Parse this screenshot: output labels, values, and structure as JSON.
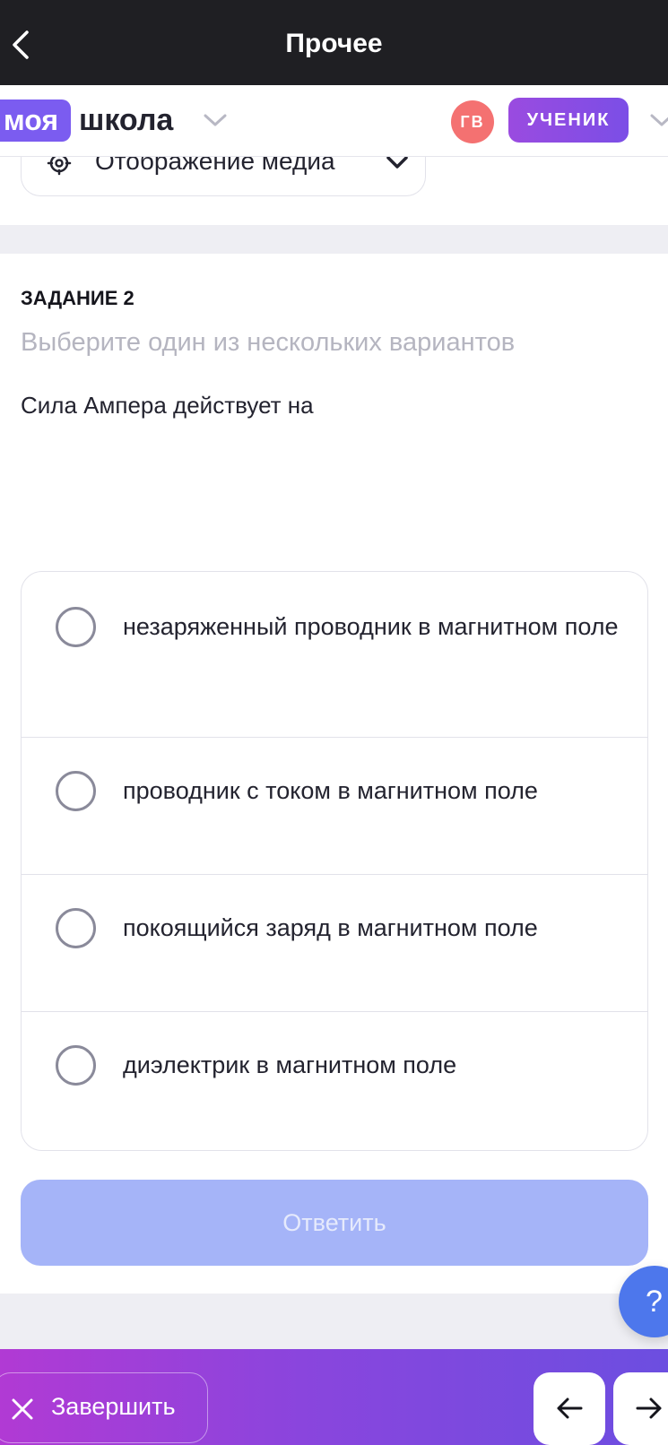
{
  "topbar": {
    "title": "Прочее"
  },
  "header": {
    "logo_badge": "моя",
    "logo_text": "школа",
    "avatar_initials": "ГВ",
    "role": "УЧЕНИК"
  },
  "media": {
    "label": "Отображение медиа"
  },
  "task": {
    "number": "ЗАДАНИЕ 2",
    "hint": "Выберите один из нескольких вариантов",
    "question": "Сила Ампера действует на",
    "options": [
      {
        "label": "незаряженный проводник в магнитном поле"
      },
      {
        "label": "проводник с током в магнитном поле"
      },
      {
        "label": "покоящийся заряд в магнитном поле"
      },
      {
        "label": "диэлектрик в магнитном поле"
      }
    ],
    "submit_label": "Ответить"
  },
  "help": {
    "label": "?"
  },
  "footer": {
    "finish_label": "Завершить"
  },
  "colors": {
    "topbar": "#1f1f23",
    "accent_purple": "#7b5cf0",
    "avatar": "#f47171",
    "submit_disabled": "#a5b4f8",
    "help": "#4d77ec"
  },
  "icons": {
    "back": "chevron-left-icon",
    "school_dropdown": "chevron-down-icon",
    "media": "gear-icon",
    "finish": "close-icon",
    "prev": "arrow-left-icon",
    "next": "arrow-right-icon"
  }
}
